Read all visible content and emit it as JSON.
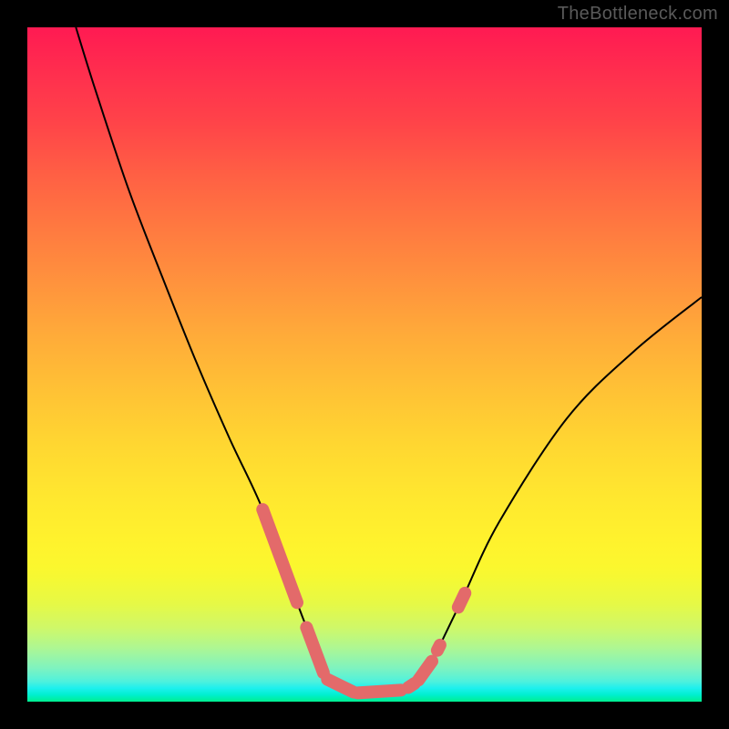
{
  "watermark": "TheBottleneck.com",
  "colors": {
    "frame": "#000000",
    "curve": "#000000",
    "marker_fill": "#e36a6a",
    "marker_stroke": "#e36a6a",
    "gradient_top": "#ff1a52",
    "gradient_bottom": "#00ef8f"
  },
  "chart_data": {
    "type": "line",
    "title": "",
    "xlabel": "",
    "ylabel": "",
    "xlim": [
      0,
      100
    ],
    "ylim": [
      0,
      100
    ],
    "grid": false,
    "legend": false,
    "series": [
      {
        "name": "bottleneck-curve",
        "x": [
          7.2,
          10,
          15,
          20,
          25,
          30,
          34.9,
          40,
          41.4,
          43.9,
          44.5,
          46,
          47,
          48.4,
          49,
          50,
          52,
          53,
          55.4,
          56.5,
          57.4,
          58,
          59,
          60,
          60.8,
          61.2,
          63.9,
          64.9,
          70,
          80,
          90,
          100
        ],
        "y": [
          100,
          91,
          76,
          63,
          50.5,
          39,
          28.5,
          14.7,
          11,
          4.3,
          3.3,
          2.2,
          1.9,
          1.4,
          1.3,
          1.3,
          1.3,
          1.3,
          1.7,
          2.1,
          2.7,
          3.2,
          4.4,
          6,
          7.6,
          8.4,
          14,
          16.1,
          26.7,
          42,
          52,
          60
        ]
      }
    ],
    "markers": [
      {
        "name": "left-1",
        "x1": 34.9,
        "y1": 28.5,
        "x2": 40.0,
        "y2": 14.7
      },
      {
        "name": "left-2",
        "x1": 41.4,
        "y1": 11.0,
        "x2": 43.9,
        "y2": 4.3
      },
      {
        "name": "left-3",
        "x1": 44.5,
        "y1": 3.3,
        "x2": 48.4,
        "y2": 1.4
      },
      {
        "name": "floor",
        "x1": 49.0,
        "y1": 1.3,
        "x2": 55.4,
        "y2": 1.7
      },
      {
        "name": "right-1",
        "x1": 56.5,
        "y1": 2.1,
        "x2": 57.4,
        "y2": 2.7
      },
      {
        "name": "right-2",
        "x1": 58.0,
        "y1": 3.2,
        "x2": 60.0,
        "y2": 6.0
      },
      {
        "name": "right-3",
        "x1": 60.8,
        "y1": 7.6,
        "x2": 61.2,
        "y2": 8.4
      },
      {
        "name": "right-4",
        "x1": 63.9,
        "y1": 14.0,
        "x2": 64.9,
        "y2": 16.1
      }
    ]
  }
}
